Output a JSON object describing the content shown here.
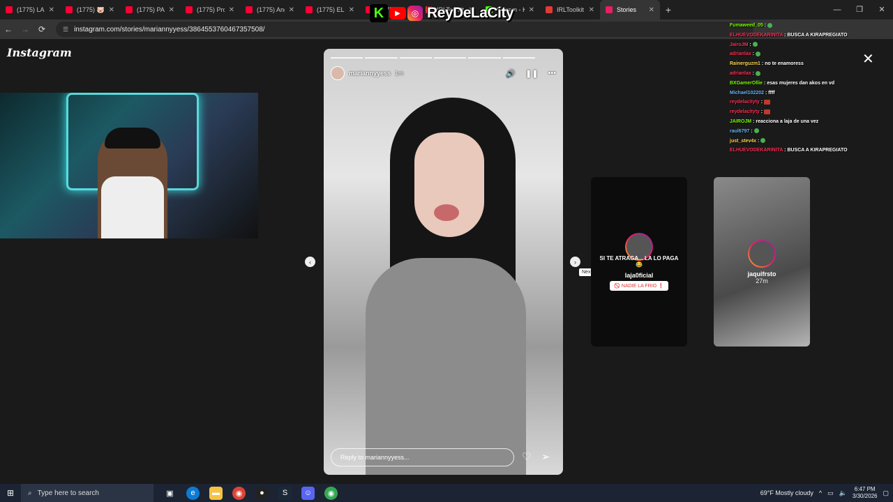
{
  "browser": {
    "tabs": [
      {
        "label": "(1775) LA...",
        "color": "#ff0033"
      },
      {
        "label": "(1775) 🐷",
        "color": "#ff0033"
      },
      {
        "label": "(1775) PA...",
        "color": "#ff0033"
      },
      {
        "label": "(1775) Pro...",
        "color": "#ff0033"
      },
      {
        "label": "(1775) Ang...",
        "color": "#ff0033"
      },
      {
        "label": "(1775) EL C...",
        "color": "#ff0033"
      },
      {
        "label": "(1775) ROI...",
        "color": "#ff0033"
      },
      {
        "label": "IRLToolkit -",
        "color": "#e53935"
      },
      {
        "label": "Stream - K...",
        "color": "#53fc18"
      },
      {
        "label": "IRLToolkit -",
        "color": "#e53935"
      },
      {
        "label": "Stories",
        "color": "#e91e63"
      }
    ],
    "url": "instagram.com/stories/mariannyyess/3864553760467357508/"
  },
  "brand": {
    "name": "ReyDeLaCity",
    "kick_letter": "K"
  },
  "instagram": {
    "logo": "Instagram",
    "story": {
      "username": "mariannyyess",
      "time": "1m",
      "reply_placeholder": "Reply to mariannyyess..."
    },
    "next_tooltip": "Next",
    "up_next": [
      {
        "username": "laja0ficial",
        "caption": "SI TE ATRAGA... LA LO PAGA 😂",
        "chip": "🚫 NADIE LA FRIO ❗"
      },
      {
        "username": "jaquifrsto",
        "time": "27m"
      }
    ]
  },
  "chat": [
    {
      "user": "Fumaweed_05",
      "msg": "",
      "color": "#7cfc00"
    },
    {
      "user": "ELHUEVODEKARINITA",
      "msg": "BUSCA A KIRAPREGIATO",
      "color": "#ff2d55"
    },
    {
      "user": "JairoJM",
      "msg": "",
      "color": "#ff2d55"
    },
    {
      "user": "adrianlax",
      "msg": "",
      "color": "#ff2d55"
    },
    {
      "user": "Rainerguzm1",
      "msg": "no te enamoress",
      "color": "#ffd54f"
    },
    {
      "user": "adrianlax",
      "msg": "",
      "color": "#ff2d55"
    },
    {
      "user": "BXGamerOllie",
      "msg": "esas mujeres dan akos en vd",
      "color": "#7cfc00"
    },
    {
      "user": "Michael102202",
      "msg": "ffff",
      "color": "#64b5f6"
    },
    {
      "user": "reydelacityty",
      "msg": "",
      "color": "#ff2d55"
    },
    {
      "user": "reydelacityty",
      "msg": "",
      "color": "#ff2d55"
    },
    {
      "user": "JAIROJM",
      "msg": "reacciona a laja de una vez",
      "color": "#7cfc00"
    },
    {
      "user": "raul6797",
      "msg": "",
      "color": "#64b5f6"
    },
    {
      "user": "just_stev4x",
      "msg": "",
      "color": "#ffd54f"
    },
    {
      "user": "ELHUEVODEKARINITA",
      "msg": "BUSCA A KIRAPREGIATO",
      "color": "#ff2d55"
    }
  ],
  "taskbar": {
    "search_placeholder": "Type here to search",
    "weather": "69°F  Mostly cloudy",
    "time": "6:47 PM",
    "date": "3/30/2026"
  }
}
